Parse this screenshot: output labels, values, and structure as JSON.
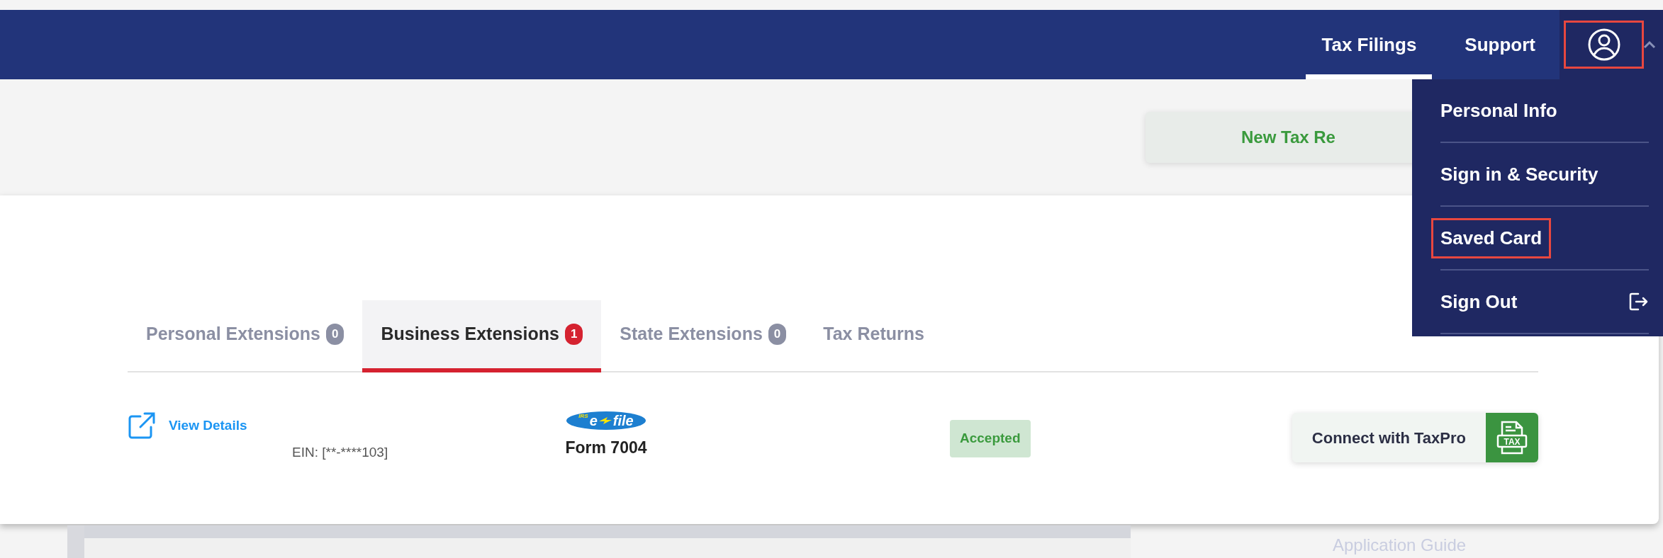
{
  "navbar": {
    "links": [
      {
        "label": "Tax Filings",
        "selected": true
      },
      {
        "label": "Support",
        "selected": false
      }
    ],
    "profile": {
      "expanded": true,
      "highlighted": true
    }
  },
  "toolbar": {
    "new_button": "New Tax Re"
  },
  "profile_menu": {
    "items": [
      {
        "label": "Personal Info",
        "kind": "link",
        "highlighted": false
      },
      {
        "label": "Sign in & Security",
        "kind": "link",
        "highlighted": false
      },
      {
        "label": "Saved Card",
        "kind": "link",
        "highlighted": true
      },
      {
        "label": "Sign Out",
        "kind": "signout",
        "highlighted": false
      }
    ]
  },
  "tabs": [
    {
      "label": "Personal Extensions",
      "count": "0",
      "selected": false
    },
    {
      "label": "Business Extensions",
      "count": "1",
      "selected": true
    },
    {
      "label": "State Extensions",
      "count": "0",
      "selected": false
    },
    {
      "label": "Tax Returns",
      "selected": false
    }
  ],
  "filing": {
    "view_details": "View Details",
    "ein": "EIN: [**-****103]",
    "logo": {
      "prefix": "IRS",
      "left": "e",
      "right": "file"
    },
    "form": "Form 7004",
    "status": "Accepted",
    "connect_button": "Connect with TaxPro",
    "connect_icon_text": "TAX"
  },
  "background": {
    "sidebar_link": "Application Guide"
  }
}
